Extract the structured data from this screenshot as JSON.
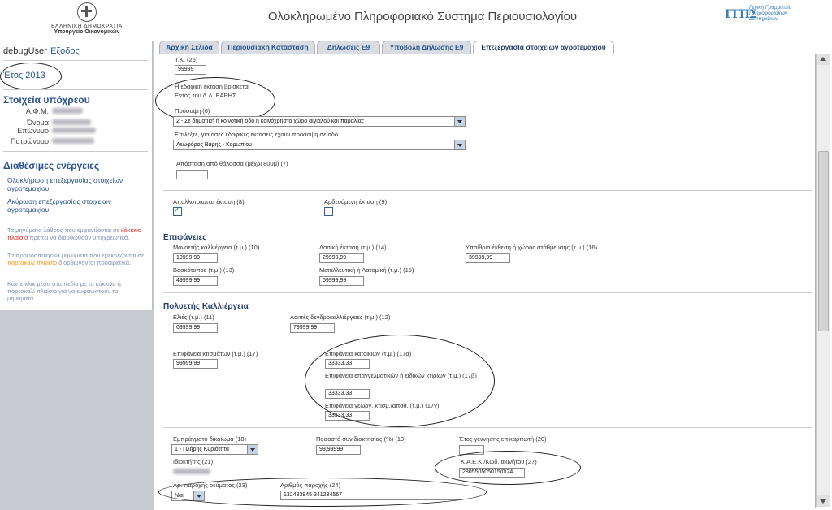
{
  "header": {
    "gov_line1": "ΕΛΛΗΝΙΚΗ ΔΗΜΟΚΡΑΤΙΑ",
    "gov_line2": "Υπουργείο Οικονομικών",
    "title": "Ολοκληρωμένο Πληροφοριακό Σύστημα Περιουσιολογίου",
    "gsis_mark": "ΓΓΠΣ",
    "gsis_text": "Γενική Γραμματεία Πληροφοριακών Συστημάτων"
  },
  "sidebar": {
    "user": "debugUser",
    "logout": "Έξοδος",
    "year": "Έτος 2013",
    "taxpayer_title": "Στοιχεία υπόχρεου",
    "fields": [
      {
        "label": "Α.Φ.Μ."
      },
      {
        "label": "Όνομα"
      },
      {
        "label": "Επώνυμο"
      },
      {
        "label": "Πατρώνυμο"
      }
    ],
    "actions_title": "Διαθέσιμες ενέργειες",
    "action1": "Ολοκλήρωση επεξεργασίας στοιχείων αγροτεμαχίου",
    "action2": "Ακύρωση επεξεργασίας στοιχείων αγροτεμαχίου",
    "note1_a": "Τα μηνύματα λάθους που εμφανίζονται σε ",
    "note1_red": "κόκκινο πλαίσιο",
    "note1_b": " πρέπει να διορθωθούν υποχρεωτικά.",
    "note2_a": "Τα προειδοποιητικά μηνύματα που εμφανίζονται σε ",
    "note2_orange": "πορτοκαλί πλαίσιο",
    "note2_b": " διορθώνονται προαιρετικά.",
    "note3": "Κάντε κλικ μέσα στα πεδία με το κόκκινο ή πορτοκαλί πλαίσιο για να εμφανιστούν τα μηνύματα."
  },
  "tabs": [
    {
      "label": "Αρχική Σελίδα"
    },
    {
      "label": "Περιουσιακή Κατάσταση"
    },
    {
      "label": "Δηλώσεις Ε9"
    },
    {
      "label": "Υποβολή Δήλωσης Ε9"
    },
    {
      "label": "Επεξεργασία στοιχείων αγροτεμαχίου"
    }
  ],
  "form": {
    "tk_label": "Τ.Κ. (25)",
    "tk_value": "99999",
    "location_label": "Η εδαφική έκταση βρίσκεται",
    "location_value": "Εντός του Δ.Δ. ΒΑΡΗΣ",
    "frontage_label": "Πρόσοψη (6)",
    "frontage_value": "2 - Σε δημοτική ή κοινοτική οδό ή κοινόχρηστο χώρο αιγιαλού και παραλίας",
    "road_label": "Επιλέξτε, για όσες εδαφικές εκτάσεις έχουν πρόσοψη σε οδό",
    "road_value": "Λεωφόρος Βάρης - Κορωπίου",
    "sea_label": "Απόσταση από θάλασσα (μέχρι 800μ) (7)",
    "sea_value": "",
    "expropriated_label": "Απαλλοτριωτέα έκταση (8)",
    "irrigated_label": "Αρδευόμενη έκταση (9)",
    "areas_heading": "Επιφάνειες",
    "annual_label": "Μονοετής καλλιέργεια (τ.μ.) (10)",
    "annual_value": "19999,99",
    "forest_label": "Δασική έκταση (τ.μ.) (14)",
    "forest_value": "29999,99",
    "outdoor_label": "Υπαίθρια έκθεση ή χώρος στάθμευσης (τ.μ.) (16)",
    "outdoor_value": "39999,99",
    "pasture_label": "Βοσκότοπος (τ.μ.) (13)",
    "pasture_value": "49999,99",
    "mine_label": "Μεταλλευτική ή Λατομική (τ.μ.) (15)",
    "mine_value": "59999,99",
    "perennial_heading": "Πολυετής Καλλιέργεια",
    "olive_label": "Ελιές (τ.μ.) (11)",
    "olive_value": "69999,99",
    "trees_label": "Λοιπές δενδροκαλλιέργειες (τ.μ.) (12)",
    "trees_value": "79999,99",
    "buildings_label": "Επιφάνεια κτισμάτων (τ.μ.) (17)",
    "buildings_value": "99999,99",
    "residential_label": "Επιφάνεια κατοικιών (τ.μ.) (17α)",
    "residential_value": "33333,33",
    "professional_label": "Επιφάνεια επαγγελματικών ή ειδικών κτιρίων (τ.μ.) (17β)",
    "professional_value": "33333,33",
    "agri_label": "Επιφάνεια γεωργ. κτισμ./αποθ. (τ.μ.) (17γ)",
    "agri_value": "33333,33",
    "right_label": "Εμπράγματο δικαίωμα (18)",
    "right_value": "1 - Πλήρης Κυριότητα",
    "percent_label": "Ποσοστό συνιδιοκτησίας (%) (19)",
    "percent_value": "99,99999",
    "birth_label": "Έτος γέννησης επικαρπωτή (20)",
    "birth_value": "",
    "owner_label": "Ιδιοκτήτης (21)",
    "kaek_label": "Κ.Α.Ε.Κ./Κωδ. ακινήτου (27)",
    "kaek_value": "280550505015/0/24",
    "supply_label": "Αρ. παροχής ρεύματος (23)",
    "supply_value": "Ναι",
    "supply_no_label": "Αριθμός παροχής (24)",
    "supply_no_value": "132483945 341234567"
  },
  "colors": {
    "accent": "#2a5290",
    "sidebar_bg": "#c7cbd1",
    "error_red": "#e0251b",
    "warning_orange": "#f09a13"
  }
}
